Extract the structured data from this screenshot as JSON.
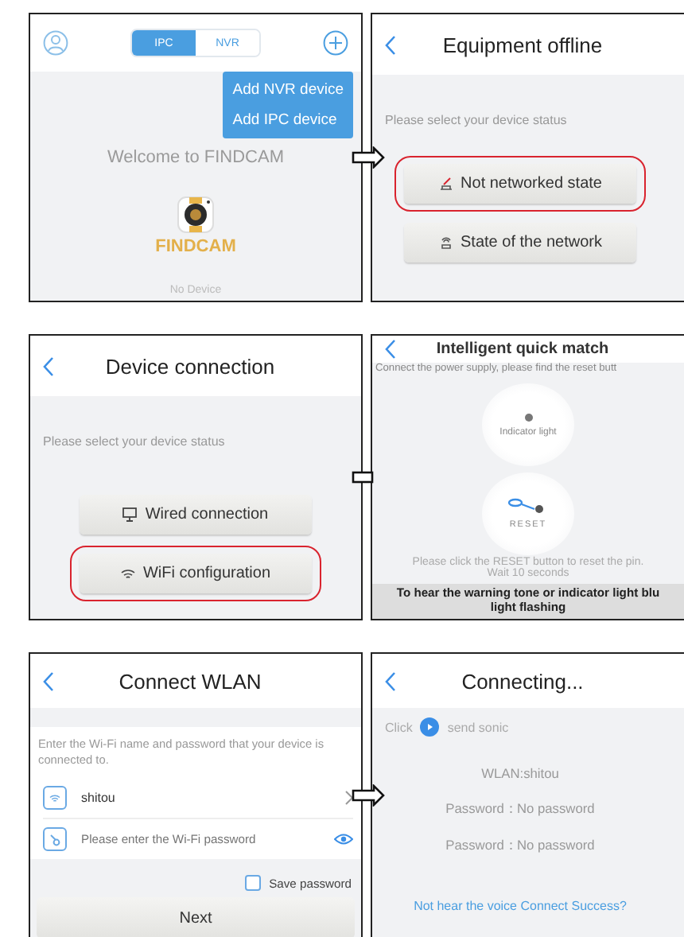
{
  "home": {
    "tabs": [
      {
        "label": "IPC",
        "selected": true
      },
      {
        "label": "NVR",
        "selected": false
      }
    ],
    "menu": [
      "Add NVR device",
      "Add IPC device"
    ],
    "welcome": "Welcome to FINDCAM",
    "logo_text": "FINDCAM",
    "empty": "No Device"
  },
  "offline": {
    "title": "Equipment offline",
    "prompt": "Please select your device status",
    "options": [
      {
        "kind": "offline",
        "label": "Not networked state",
        "highlighted": true
      },
      {
        "kind": "online",
        "label": "State of the network",
        "highlighted": false
      }
    ]
  },
  "connection": {
    "title": "Device connection",
    "prompt": "Please select your device status",
    "options": [
      {
        "kind": "wired",
        "label": "Wired connection",
        "highlighted": false
      },
      {
        "kind": "wifi",
        "label": "WiFi configuration",
        "highlighted": true
      }
    ]
  },
  "quick_match": {
    "title": "Intelligent quick match",
    "instruction": "Connect the power supply, please find the reset butt",
    "indicator": "Indicator light",
    "reset": "RESET",
    "hint": "Please click the RESET button to reset the pin.",
    "wait": "Wait 10 seconds",
    "notice": [
      "To hear the warning tone or indicator light blu",
      "light flashing"
    ]
  },
  "wlan": {
    "title": "Connect WLAN",
    "hint": "Enter the Wi-Fi name and password that your device is connected to.",
    "ssid": "shitou",
    "password_placeholder": "Please enter the Wi-Fi password",
    "save": {
      "label": "Save password",
      "checked": false
    },
    "next": "Next"
  },
  "connecting": {
    "title": "Connecting...",
    "click": "Click",
    "send": "send sonic",
    "wlan": "WLAN:shitou",
    "lines": [
      "Password：No password",
      "Password：No password"
    ],
    "link": "Not hear the voice Connect Success?"
  }
}
